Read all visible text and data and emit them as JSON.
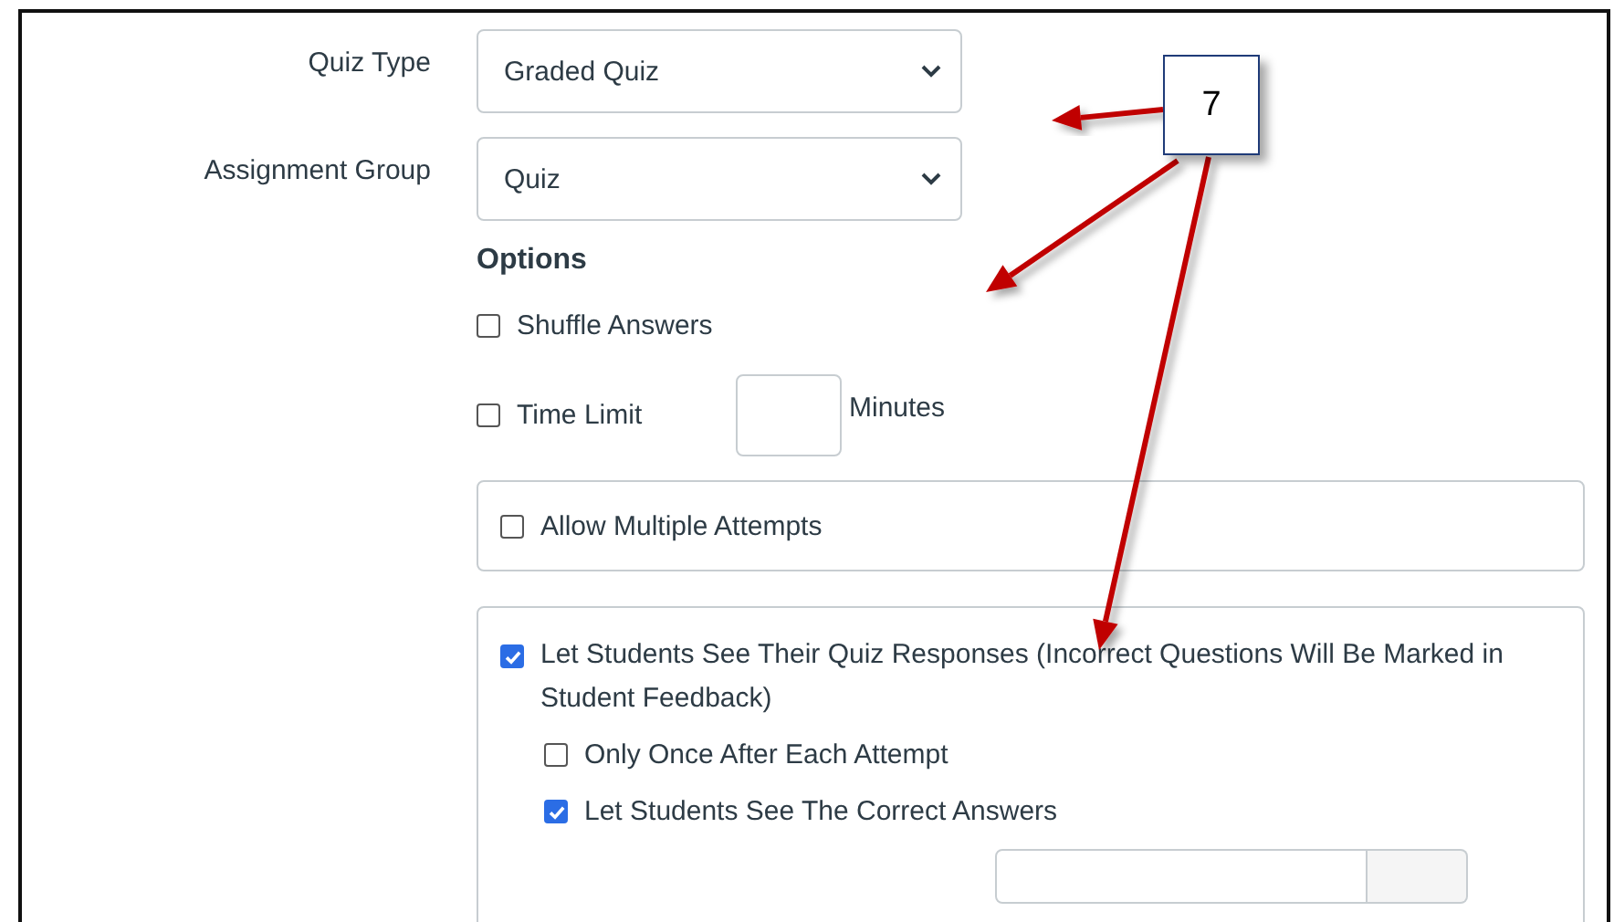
{
  "fields": [
    {
      "label": "Quiz Type",
      "value": "Graded Quiz"
    },
    {
      "label": "Assignment Group",
      "value": "Quiz"
    }
  ],
  "options": {
    "heading": "Options",
    "shuffle": {
      "label": "Shuffle Answers",
      "checked": false
    },
    "time_limit": {
      "label": "Time Limit",
      "checked": false,
      "unit": "Minutes"
    },
    "multiple_attempts": {
      "label": "Allow Multiple Attempts",
      "checked": false
    },
    "see_responses": {
      "label": "Let Students See Their Quiz Responses (Incorrect Questions Will Be Marked in Student Feedback)",
      "checked": true,
      "children": [
        {
          "label": "Only Once After Each Attempt",
          "checked": false
        },
        {
          "label": "Let Students See The Correct Answers",
          "checked": true
        }
      ]
    }
  },
  "callout": {
    "label": "7"
  }
}
